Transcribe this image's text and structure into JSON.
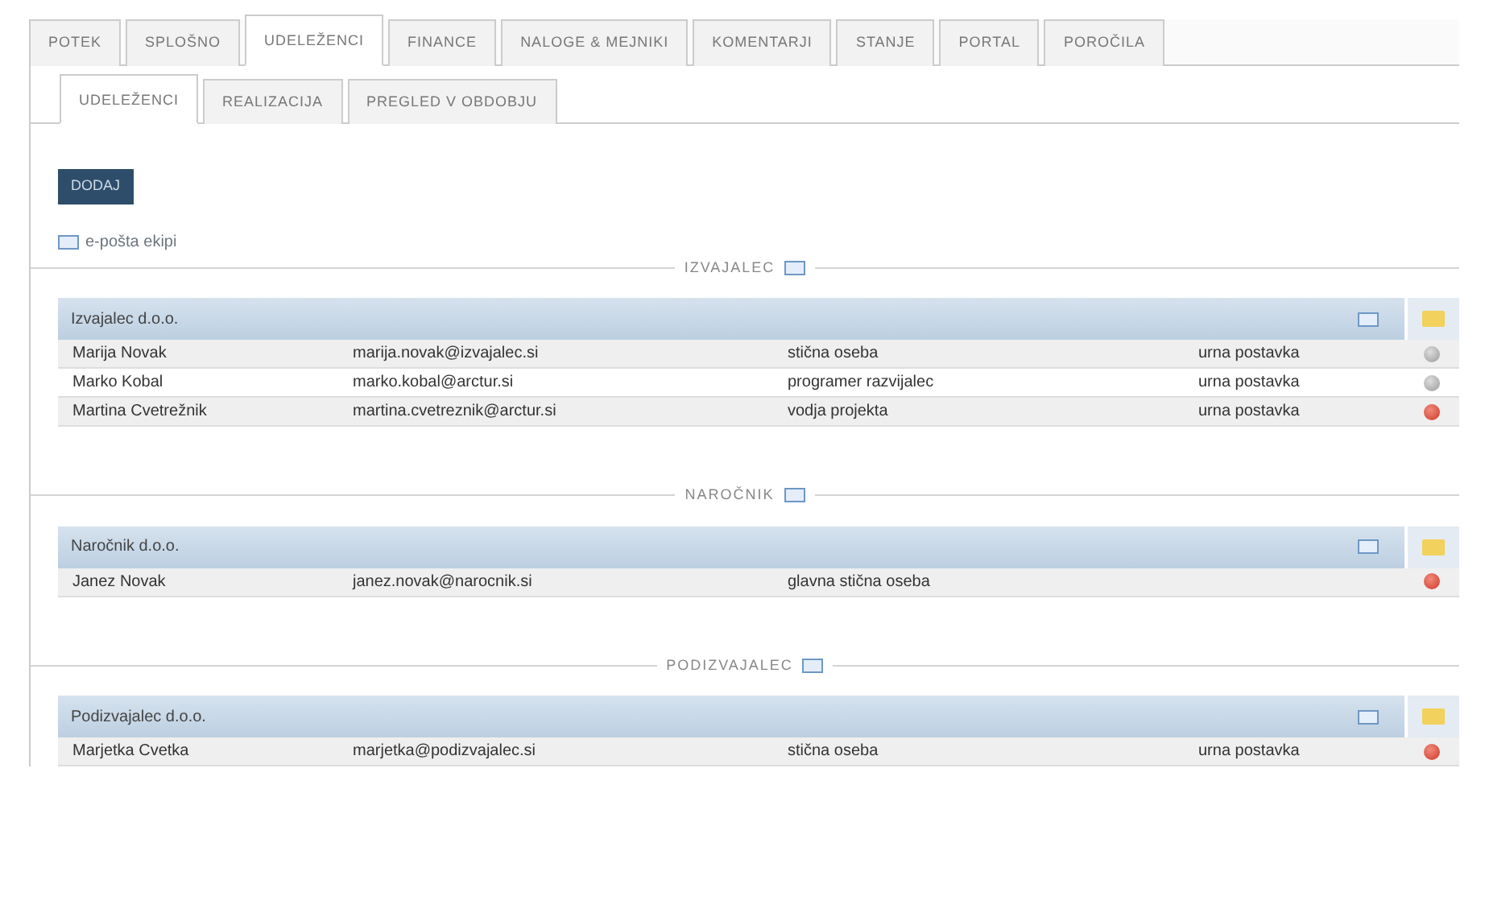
{
  "tabs": [
    {
      "label": "POTEK",
      "selected": false
    },
    {
      "label": "SPLOŠNO",
      "selected": false
    },
    {
      "label": "UDELEŽENCI",
      "selected": true
    },
    {
      "label": "FINANCE",
      "selected": false
    },
    {
      "label": "NALOGE & MEJNIKI",
      "selected": false
    },
    {
      "label": "KOMENTARJI",
      "selected": false
    },
    {
      "label": "STANJE",
      "selected": false
    },
    {
      "label": "PORTAL",
      "selected": false
    },
    {
      "label": "POROČILA",
      "selected": false
    }
  ],
  "subtabs": [
    {
      "label": "UDELEŽENCI",
      "selected": true
    },
    {
      "label": "REALIZACIJA",
      "selected": false
    },
    {
      "label": "PREGLED V OBDOBJU",
      "selected": false
    }
  ],
  "add_button": "DODAJ",
  "team_email": "e-pošta ekipi",
  "sections": [
    {
      "heading": "IZVAJALEC",
      "company": "Izvajalec d.o.o.",
      "rows": [
        {
          "name": "Marija Novak",
          "email": "marija.novak@izvajalec.si",
          "role": "stična oseba",
          "rate": "urna postavka",
          "removable": false
        },
        {
          "name": "Marko Kobal",
          "email": "marko.kobal@arctur.si",
          "role": "programer razvijalec",
          "rate": "urna postavka",
          "removable": false
        },
        {
          "name": "Martina Cvetrežnik",
          "email": "martina.cvetreznik@arctur.si",
          "role": "vodja projekta",
          "rate": "urna postavka",
          "removable": true
        }
      ]
    },
    {
      "heading": "NAROČNIK",
      "company": "Naročnik d.o.o.",
      "rows": [
        {
          "name": "Janez Novak",
          "email": "janez.novak@narocnik.si",
          "role": "glavna stična oseba",
          "removable": true
        }
      ]
    },
    {
      "heading": "PODIZVAJALEC",
      "company": "Podizvajalec d.o.o.",
      "rows": [
        {
          "name": "Marjetka Cvetka",
          "email": "marjetka@podizvajalec.si",
          "role": "stična oseba",
          "rate": "urna postavka",
          "removable": true
        }
      ]
    }
  ]
}
